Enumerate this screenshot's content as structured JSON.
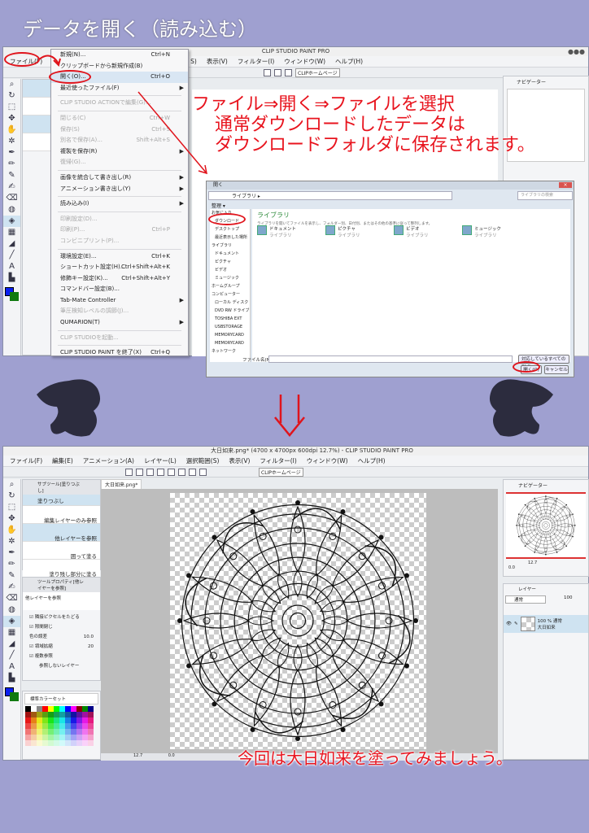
{
  "heading": "データを開く（読み込む）",
  "top_window": {
    "title": "CLIP STUDIO PAINT PRO",
    "menu_visible": [
      "ファイル(F)",
      "S)",
      "表示(V)",
      "フィルター(I)",
      "ウィンドウ(W)",
      "ヘルプ(H)"
    ],
    "toolbar_link": "CLIPホームページ",
    "navigator_tab": "ナビゲーター",
    "file_menu": [
      {
        "label": "新規(N)...",
        "shortcut": "Ctrl+N"
      },
      {
        "label": "クリップボードから新規作成(B)"
      },
      {
        "label": "開く(O)...",
        "shortcut": "Ctrl+O",
        "highlight": true
      },
      {
        "label": "最近使ったファイル(F)",
        "submenu": true
      },
      {
        "sep": true
      },
      {
        "label": "CLIP STUDIO ACTIONで編集(G)...",
        "disabled": true
      },
      {
        "sep": true
      },
      {
        "label": "閉じる(C)",
        "shortcut": "Ctrl+W",
        "disabled": true
      },
      {
        "label": "保存(S)",
        "shortcut": "Ctrl+S",
        "disabled": true
      },
      {
        "label": "別名で保存(A)...",
        "shortcut": "Shift+Alt+S",
        "disabled": true
      },
      {
        "label": "複製を保存(R)",
        "submenu": true
      },
      {
        "label": "復帰(G)...",
        "disabled": true
      },
      {
        "sep": true
      },
      {
        "label": "画像を統合して書き出し(R)",
        "submenu": true
      },
      {
        "label": "アニメーション書き出し(Y)",
        "submenu": true
      },
      {
        "sep": true
      },
      {
        "label": "読み込み(I)",
        "submenu": true
      },
      {
        "sep": true
      },
      {
        "label": "印刷設定(D)...",
        "disabled": true
      },
      {
        "label": "印刷(P)...",
        "shortcut": "Ctrl+P",
        "disabled": true
      },
      {
        "label": "コンビニプリント(P)...",
        "disabled": true
      },
      {
        "sep": true
      },
      {
        "label": "環境設定(E)...",
        "shortcut": "Ctrl+K"
      },
      {
        "label": "ショートカット設定(H)...",
        "shortcut": "Ctrl+Shift+Alt+K"
      },
      {
        "label": "修飾キー設定(K)...",
        "shortcut": "Ctrl+Shift+Alt+Y"
      },
      {
        "label": "コマンドバー設定(B)..."
      },
      {
        "label": "Tab-Mate Controller",
        "submenu": true
      },
      {
        "label": "筆圧検知レベルの調節(J)...",
        "disabled": true
      },
      {
        "label": "QUMARION(T)",
        "submenu": true
      },
      {
        "sep": true
      },
      {
        "label": "CLIP STUDIOを起動...",
        "disabled": true
      },
      {
        "sep": true
      },
      {
        "label": "CLIP STUDIO PAINT を終了(X)",
        "shortcut": "Ctrl+Q"
      }
    ]
  },
  "instruction_lines": [
    "ファイル⇒開く⇒ファイルを選択",
    "通常ダウンロードしたデータは",
    "ダウンロードフォルダに保存されます。"
  ],
  "open_dialog": {
    "title": "開く",
    "breadcrumb": "ライブラリ ▸",
    "search_placeholder": "ライブラリの検索",
    "organize": "整理 ▾",
    "nav": [
      "お気に入り",
      "ダウンロード",
      "デスクトップ",
      "最近表示した場所",
      "ライブラリ",
      "ドキュメント",
      "ピクチャ",
      "ビデオ",
      "ミュージック",
      "ホームグループ",
      "コンピューター",
      "ローカル ディスク",
      "DVD RW ドライブ",
      "TOSHIBA EXT",
      "USBSTORAGE",
      "MEMORYCARD",
      "MEMORYCARD",
      "ネットワーク"
    ],
    "header": "ライブラリ",
    "description": "ライブラリを開いてファイルを表示し、フォルダー別、日付別、またはその他の基準に従って整列します。",
    "libraries": [
      {
        "name": "ドキュメント",
        "sub": "ライブラリ"
      },
      {
        "name": "ピクチャ",
        "sub": "ライブラリ"
      },
      {
        "name": "ビデオ",
        "sub": "ライブラリ"
      },
      {
        "name": "ミュージック",
        "sub": "ライブラリ"
      }
    ],
    "filename_label": "ファイル名(N):",
    "filetype": "対応しているすべての形式",
    "open_button": "開く(O)",
    "cancel_button": "キャンセル"
  },
  "bottom_window": {
    "title": "大日如来.png* (4700 x 4700px 600dpi 12.7%) - CLIP STUDIO PAINT PRO",
    "menu": [
      "ファイル(F)",
      "編集(E)",
      "アニメーション(A)",
      "レイヤー(L)",
      "選択範囲(S)",
      "表示(V)",
      "フィルター(I)",
      "ウィンドウ(W)",
      "ヘルプ(H)"
    ],
    "toolbar_link": "CLIPホームページ",
    "doc_tab": "大日如来.png*",
    "subtool_header": "サブツール[塗りつぶし]",
    "subtools": [
      "塗りつぶし",
      "編集レイヤーのみ参照",
      "他レイヤーを参照",
      "囲って塗る",
      "塗り残し部分に塗る"
    ],
    "tool_property_header": "ツールプロパティ[他レイヤーを参照]",
    "tool_property_name": "他レイヤーを参照",
    "props": {
      "follow": "隣接ピクセルをたどる",
      "close_gap": "隙間閉じ",
      "tolerance_label": "色の誤差",
      "tolerance": "10.0",
      "expand_label": "領域拡縮",
      "expand": "20",
      "reference": "複数参照",
      "ignore": "参照しないレイヤー"
    },
    "color_set": "標準カラーセット",
    "navigator_tab": "ナビゲーター",
    "zoom": "12.7",
    "rotation": "0.0",
    "layer_tab": "レイヤー",
    "blend_mode": "通常",
    "opacity": "100",
    "layer": {
      "opacity_mode": "100 % 通常",
      "name": "大日如来"
    },
    "canvas_zoom": "12.7",
    "canvas_rotation": "0.0"
  },
  "closing": "今回は大日如来を塗ってみましょう。",
  "colors": {
    "bg": "#9fa0d0",
    "accent": "#e8141e",
    "fg_color": "#0a1ef0",
    "bg_color": "#107a10"
  }
}
